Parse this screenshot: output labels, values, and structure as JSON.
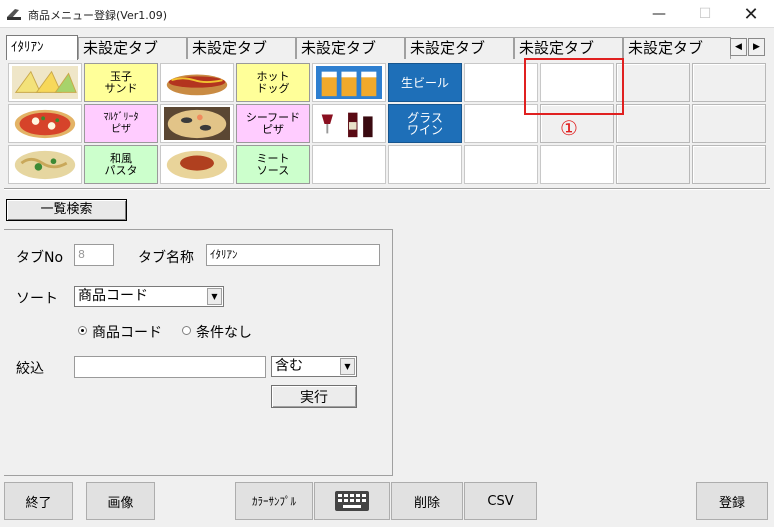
{
  "window": {
    "title": "商品メニュー登録(Ver1.09)",
    "controls": {
      "minimize": "—",
      "maximize": "☐",
      "close": "✕"
    }
  },
  "tabs": [
    {
      "label": "ｲﾀﾘｱﾝ",
      "active": true
    },
    {
      "label": "未設定タブ"
    },
    {
      "label": "未設定タブ"
    },
    {
      "label": "未設定タブ"
    },
    {
      "label": "未設定タブ"
    },
    {
      "label": "未設定タブ"
    },
    {
      "label": "未設定タブ"
    }
  ],
  "tab_scroll": {
    "left": "◀",
    "right": "▶"
  },
  "menu_grid": {
    "row1": {
      "egg_sandwich": "玉子\nサンド",
      "hotdog": "ホット\nドッグ",
      "draft_beer": "生ビール"
    },
    "row2": {
      "margherita": "ﾏﾙｹﾞﾘｰﾀ\nピザ",
      "seafood_pizza": "シーフード\nピザ",
      "glass_wine": "グラス\nワイン"
    },
    "row3": {
      "wafu_pasta": "和風\nパスタ",
      "meat_sauce": "ミート\nソース"
    }
  },
  "annotation": {
    "number": "①"
  },
  "list_search_button": "一覧検索",
  "form": {
    "tab_no_label": "タブNo",
    "tab_no_value": "8",
    "tab_name_label": "タブ名称",
    "tab_name_value": "ｲﾀﾘｱﾝ",
    "sort_label": "ソート",
    "sort_value": "商品コード",
    "radio_product_code": "商品コード",
    "radio_no_condition": "条件なし",
    "filter_label": "絞込",
    "filter_value": "",
    "match_value": "含む",
    "execute_button": "実行"
  },
  "bottom_buttons": {
    "exit": "終了",
    "image": "画像",
    "color_sample": "ｶﾗｰｻﾝﾌﾟﾙ",
    "keyboard": "keyboard-icon",
    "delete": "削除",
    "csv": "CSV",
    "register": "登録"
  },
  "colors": {
    "yellow_item": "#ffff99",
    "pink_item": "#ffccff",
    "green_item": "#ccffcc",
    "blue_item": "#1e6fb8",
    "annotation_red": "#e02020"
  }
}
